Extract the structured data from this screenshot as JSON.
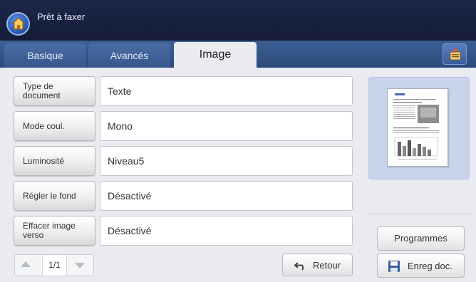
{
  "header": {
    "title": "Prêt à faxer"
  },
  "tabs": [
    {
      "label": "Basique",
      "active": false
    },
    {
      "label": "Avancés",
      "active": false
    },
    {
      "label": "Image",
      "active": true
    }
  ],
  "options": [
    {
      "label_lines": [
        "Type de",
        "document"
      ],
      "value": "Texte"
    },
    {
      "label_lines": [
        "Mode coul."
      ],
      "value": "Mono"
    },
    {
      "label_lines": [
        "Luminosité"
      ],
      "value": "Niveau5"
    },
    {
      "label_lines": [
        "Régler le fond"
      ],
      "value": "Désactivé"
    },
    {
      "label_lines": [
        "Effacer image",
        "verso"
      ],
      "value": "Désactivé"
    }
  ],
  "pager": {
    "page": "1/1"
  },
  "buttons": {
    "back": "Retour",
    "programs": "Programmes",
    "save_doc": "Enreg doc."
  },
  "colors": {
    "title_bar": "#1c2648",
    "tab_bar": "#2b4a7b",
    "panel_bg": "#e9ebf0",
    "preview_bg": "#c7d4ea"
  },
  "icons": {
    "home": "home-icon",
    "job_status": "job-status-icon",
    "back": "undo-arrow-icon",
    "save": "floppy-disk-icon"
  }
}
